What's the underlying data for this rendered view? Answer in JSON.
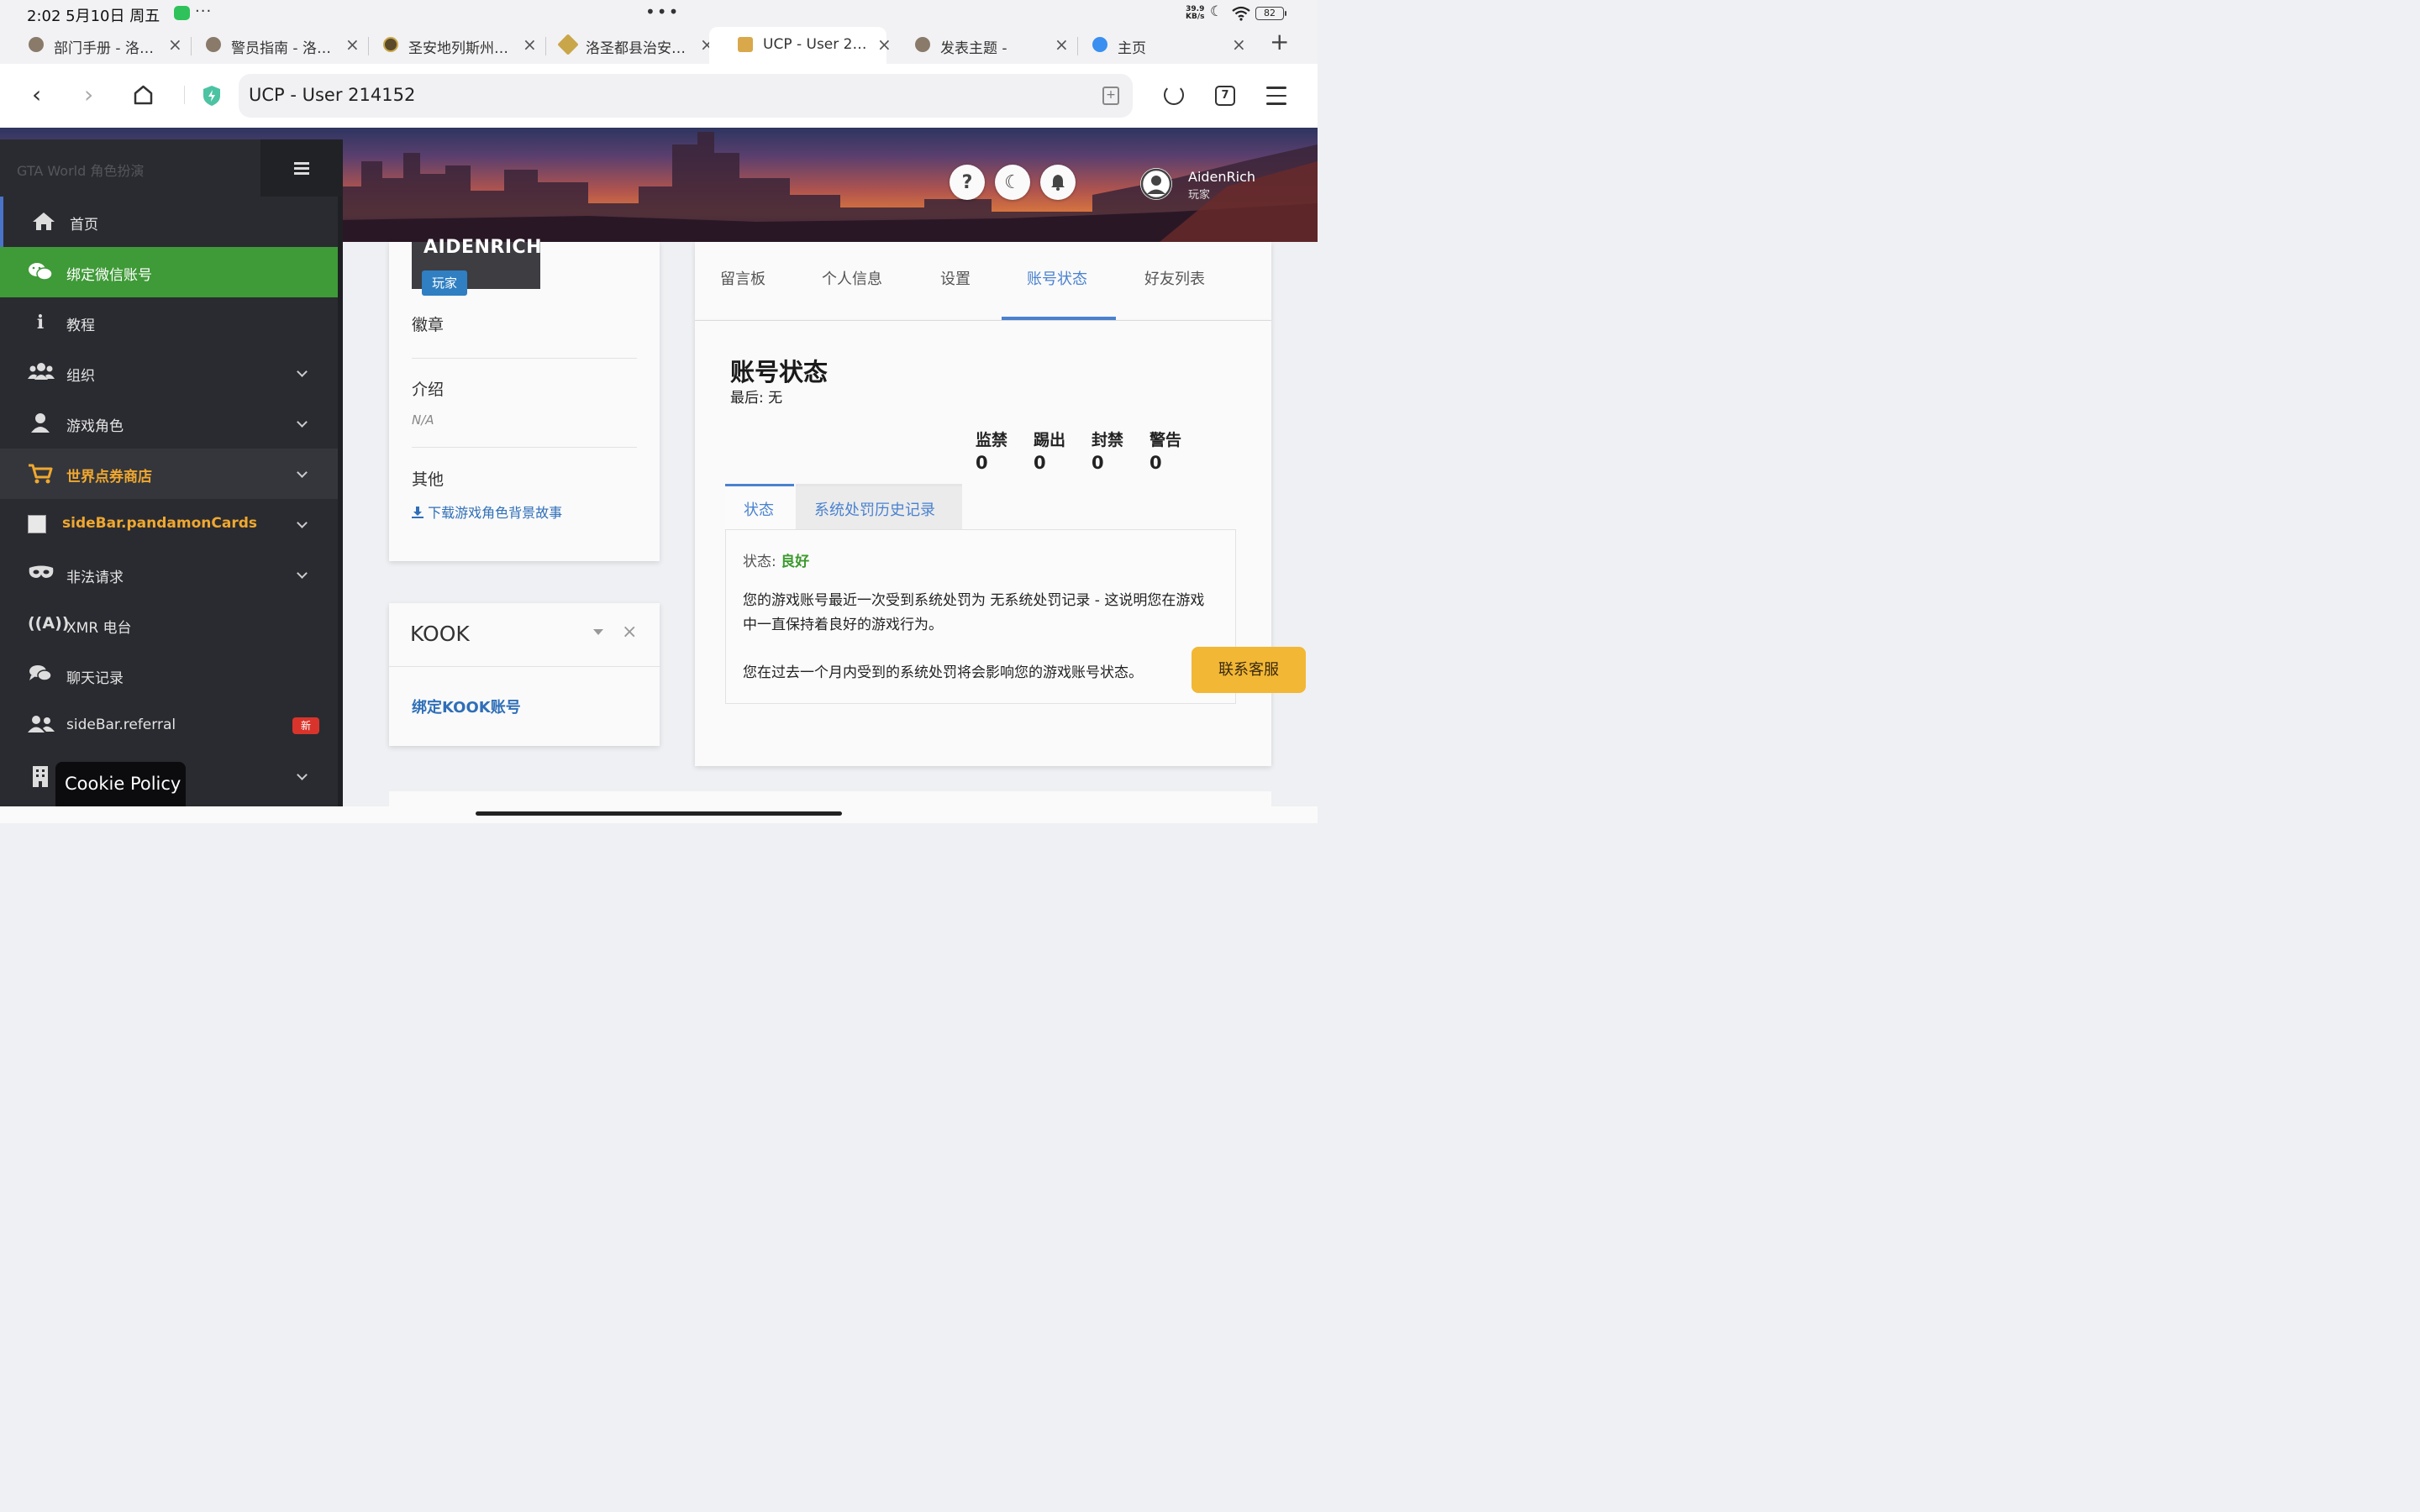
{
  "status_bar": {
    "time": "2:02  5月10日 周五",
    "more": "···",
    "center_dots": "•••",
    "net_speed_value": "39.9",
    "net_speed_unit": "KB/s",
    "battery": "82"
  },
  "tabs": [
    {
      "label": "部门手册 - 洛…",
      "close": "×"
    },
    {
      "label": "警员指南 - 洛…",
      "close": "×"
    },
    {
      "label": "圣安地列斯州…",
      "close": "×"
    },
    {
      "label": "洛圣都县治安…",
      "close": "×"
    },
    {
      "label": "UCP - User 2…",
      "close": "×"
    },
    {
      "label": "发表主题 -",
      "close": "×"
    },
    {
      "label": "主页",
      "close": "×"
    }
  ],
  "tab_add": "+",
  "toolbar": {
    "back": "‹",
    "forward": "›",
    "url": "UCP - User 214152",
    "tabs_count": "7"
  },
  "header": {
    "help": "?",
    "username": "AidenRich",
    "role": "玩家"
  },
  "sidebar": {
    "brand": "GTA World 角色扮演",
    "items": [
      {
        "label": "首页"
      },
      {
        "label": "绑定微信账号"
      },
      {
        "label": "教程"
      },
      {
        "label": "组织"
      },
      {
        "label": "游戏角色"
      },
      {
        "label": "世界点券商店"
      },
      {
        "label": "sideBar.pandamonCards"
      },
      {
        "label": "非法请求"
      },
      {
        "label": "XMR 电台"
      },
      {
        "label": "聊天记录"
      },
      {
        "label": "sideBar.referral",
        "badge": "新"
      },
      {
        "label": ""
      }
    ],
    "cookie": "Cookie Policy"
  },
  "profile": {
    "name": "AIDENRICH",
    "role": "玩家",
    "badges_label": "徽章",
    "intro_label": "介绍",
    "intro_value": "N/A",
    "other_label": "其他",
    "download_link": "下载游戏角色背景故事"
  },
  "kook": {
    "title": "KOOK",
    "close": "×",
    "link": "绑定KOOK账号"
  },
  "main_tabs": [
    {
      "label": "留言板"
    },
    {
      "label": "个人信息"
    },
    {
      "label": "设置"
    },
    {
      "label": "账号状态"
    },
    {
      "label": "好友列表"
    }
  ],
  "account_status": {
    "title": "账号状态",
    "last": "最后: 无",
    "stats": [
      {
        "label": "监禁",
        "value": "0"
      },
      {
        "label": "踢出",
        "value": "0"
      },
      {
        "label": "封禁",
        "value": "0"
      },
      {
        "label": "警告",
        "value": "0"
      }
    ],
    "sub_tabs": [
      {
        "label": "状态"
      },
      {
        "label": "系统处罚历史记录"
      }
    ],
    "status_label": "状态: ",
    "status_value": "良好",
    "para1": "您的游戏账号最近一次受到系统处罚为 无系统处罚记录 - 这说明您在游戏中一直保持着良好的游戏行为。",
    "para2": "您在过去一个月内受到的系统处罚将会影响您的游戏账号状态。"
  },
  "contact_button": "联系客服",
  "colors": {
    "sidebar_bg": "#2a2b30",
    "wechat_active": "#3f9a38",
    "shop_text": "#f0a830",
    "link_blue": "#2f6fb8",
    "tab_active": "#4a82d0",
    "status_good": "#3d9a2f",
    "contact_button": "#f2b735",
    "badge_red": "#d9342b"
  }
}
